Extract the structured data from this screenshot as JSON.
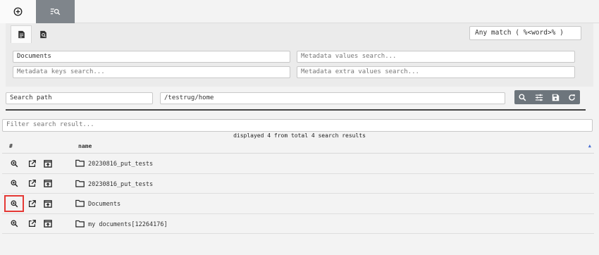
{
  "top_tabs": [
    {
      "icon": "add-circle-icon"
    },
    {
      "icon": "search-list-icon",
      "active": true
    }
  ],
  "sub_tabs": [
    {
      "icon": "document-icon",
      "active": true
    },
    {
      "icon": "document-search-icon"
    }
  ],
  "any_match": "Any match ( %<word>% )",
  "filters": {
    "documents_value": "Documents",
    "metadata_values_placeholder": "Metadata values search...",
    "metadata_keys_placeholder": "Metadata keys search...",
    "metadata_extra_placeholder": "Metadata extra values search..."
  },
  "search_path": {
    "label": "Search path",
    "value": "/testrug/home"
  },
  "toolbar_icons": [
    "search-icon",
    "sliders-icon",
    "save-icon",
    "refresh-icon"
  ],
  "result_filter_placeholder": "Filter search result...",
  "info_text": "displayed 4 from total 4 search results",
  "table": {
    "col_hash": "#",
    "col_name": "name",
    "rows": [
      {
        "name": "20230816_put_tests"
      },
      {
        "name": "20230816_put_tests"
      },
      {
        "name": "Documents",
        "highlighted": true
      },
      {
        "name": "my documents[12264176]"
      }
    ]
  },
  "colors": {
    "active_top_tab": "#7f858b",
    "toolbar": "#6d757c",
    "highlight": "#e53935",
    "sort_arrow": "#4a6fd1"
  }
}
